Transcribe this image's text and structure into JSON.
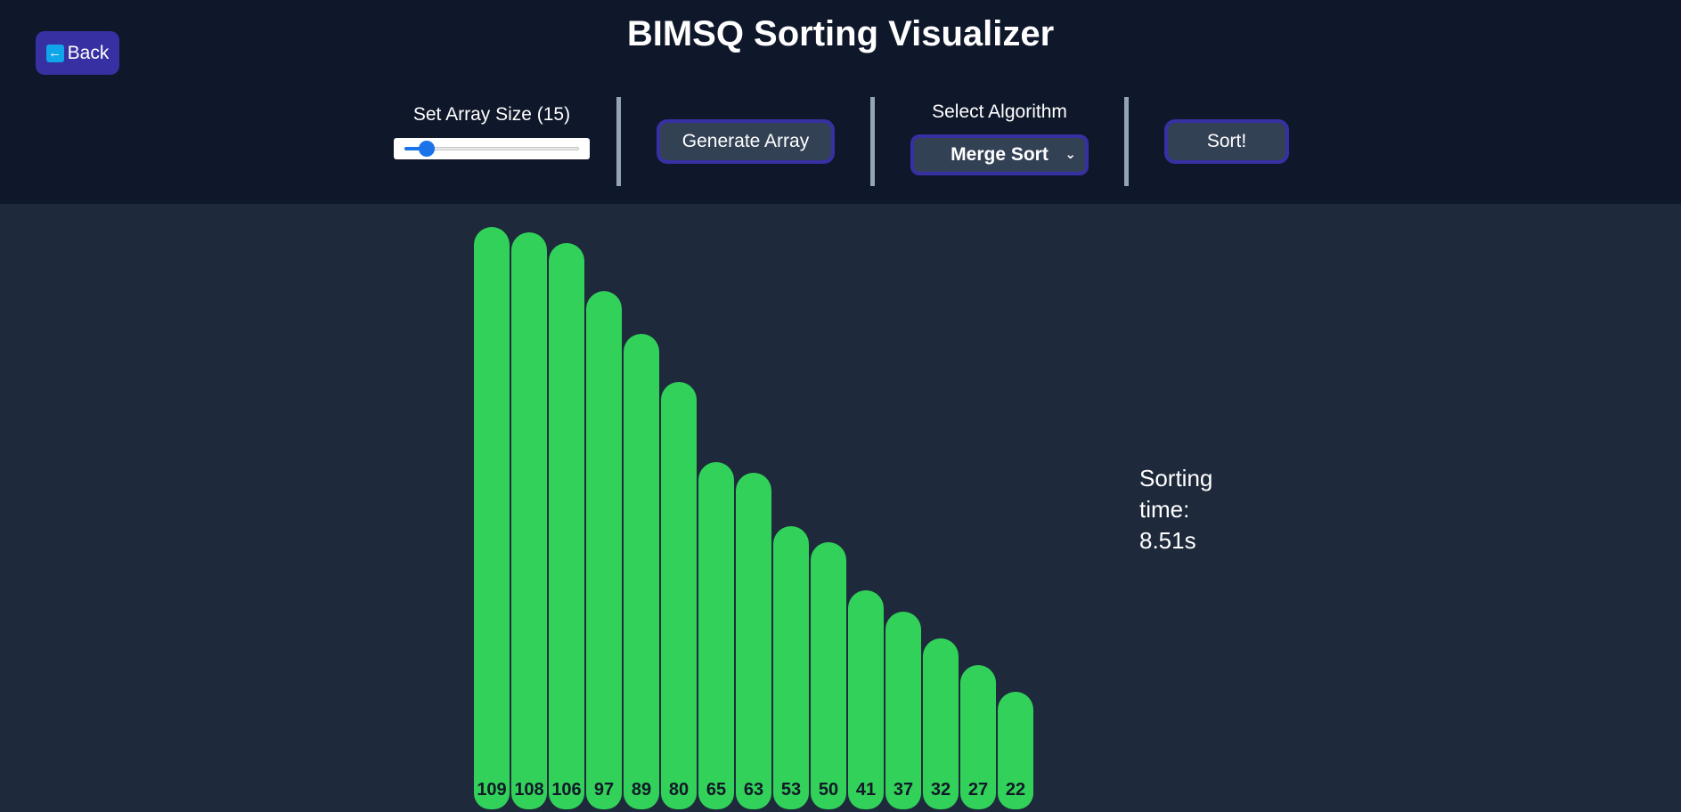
{
  "header": {
    "title": "BIMSQ Sorting Visualizer",
    "back_label": "Back",
    "back_icon": "left-arrow-icon"
  },
  "controls": {
    "array_size_label": "Set Array Size (15)",
    "array_size": 15,
    "slider_fraction": 0.13,
    "generate_label": "Generate Array",
    "algorithm_label": "Select Algorithm",
    "algorithm_selected": "Merge Sort",
    "sort_label": "Sort!"
  },
  "colors": {
    "header_bg": "#0f172a",
    "page_bg": "#1e293b",
    "accent": "#3730a3",
    "bar": "#32d25a",
    "button_bg": "#334155"
  },
  "chart_data": {
    "type": "bar",
    "categories": [
      "109",
      "108",
      "106",
      "97",
      "89",
      "80",
      "65",
      "63",
      "53",
      "50",
      "41",
      "37",
      "32",
      "27",
      "22"
    ],
    "values": [
      109,
      108,
      106,
      97,
      89,
      80,
      65,
      63,
      53,
      50,
      41,
      37,
      32,
      27,
      22
    ],
    "title": "",
    "xlabel": "",
    "ylabel": "",
    "grid": false
  },
  "status": {
    "sorting_time_line1": "Sorting",
    "sorting_time_line2": "time:",
    "sorting_time_value": "8.51s"
  }
}
